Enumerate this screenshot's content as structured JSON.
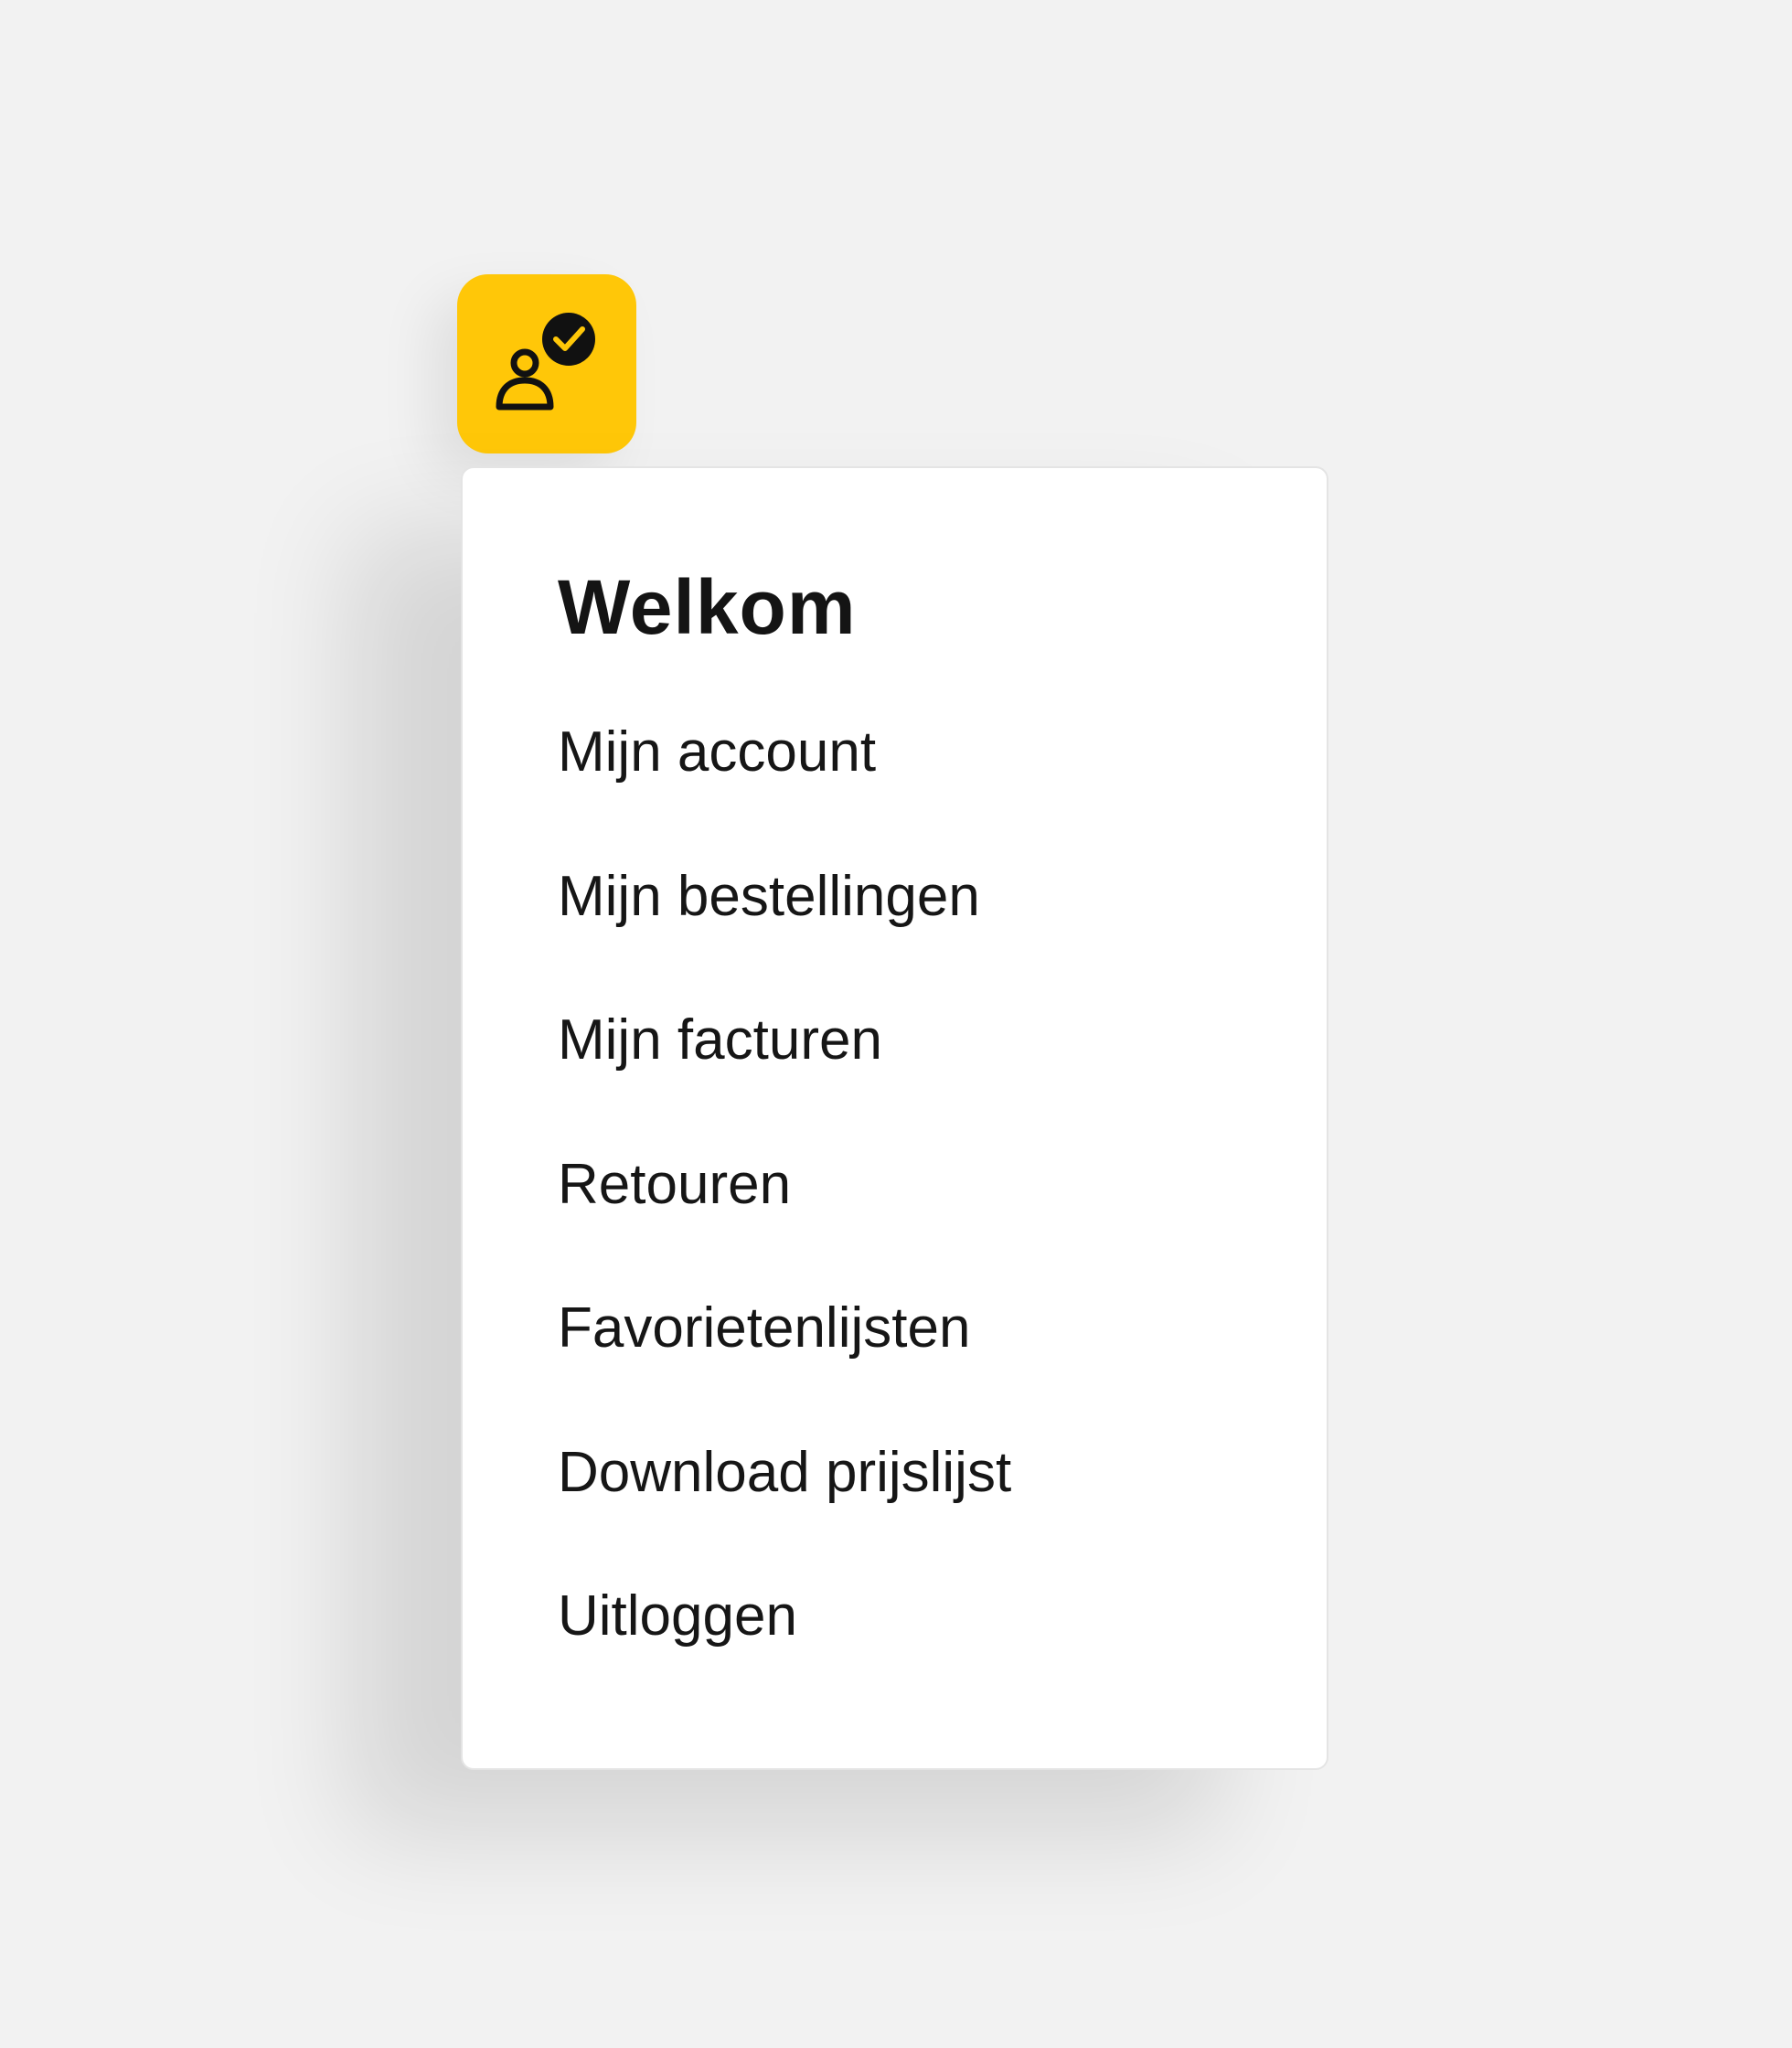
{
  "account_button": {
    "icon": "user-check-icon",
    "color": "#ffc708"
  },
  "menu": {
    "title": "Welkom",
    "items": [
      {
        "label": "Mijn account"
      },
      {
        "label": "Mijn bestellingen"
      },
      {
        "label": "Mijn facturen"
      },
      {
        "label": "Retouren"
      },
      {
        "label": "Favorietenlijsten"
      },
      {
        "label": "Download prijslijst"
      },
      {
        "label": "Uitloggen"
      }
    ]
  }
}
